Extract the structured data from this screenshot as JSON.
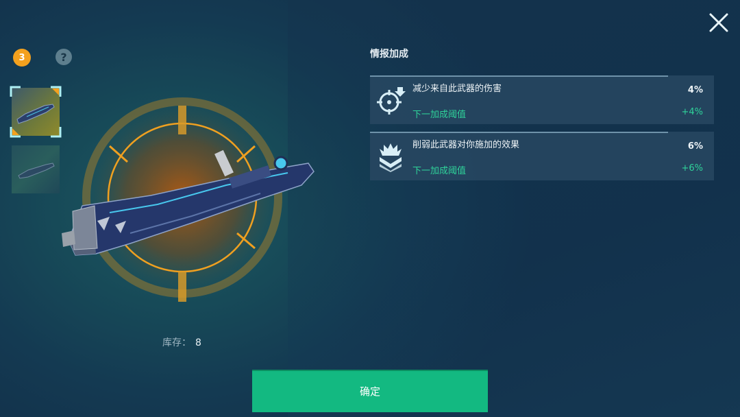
{
  "header": {
    "title": "情报加成",
    "selected_count": "3",
    "help_icon": "?"
  },
  "weapons": [
    {
      "name": "weapon-thumb-1",
      "selected": true
    },
    {
      "name": "weapon-thumb-2",
      "selected": false
    }
  ],
  "stock": {
    "label": "库存：",
    "value": "8"
  },
  "bonuses": [
    {
      "icon": "crosshair-down-icon",
      "name": "减少来自此武器的伤害",
      "value": "4%",
      "next_label": "下一加成阈值",
      "next_value": "+4%"
    },
    {
      "icon": "chevron-burst-icon",
      "name": "削弱此武器对你施加的效果",
      "value": "6%",
      "next_label": "下一加成阈值",
      "next_value": "+6%"
    }
  ],
  "confirm_label": "确定",
  "colors": {
    "accent_orange": "#f4a11e",
    "confirm_green": "#13b981",
    "bonus_green": "#2fd39a",
    "frame_cyan": "#aef0f4"
  }
}
